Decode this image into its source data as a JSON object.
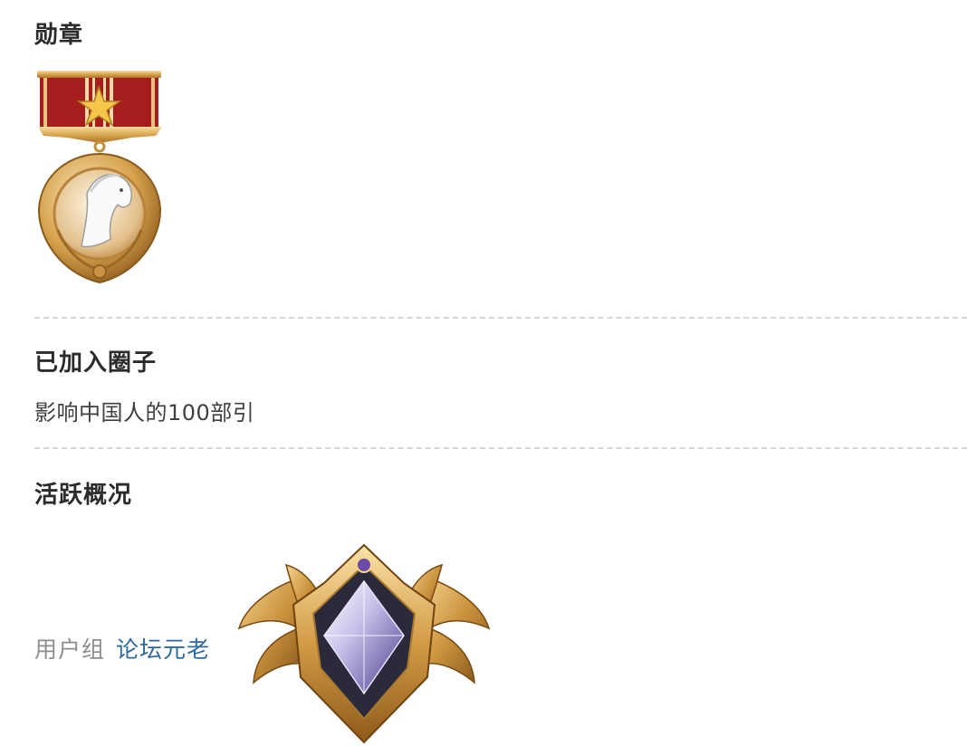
{
  "sections": {
    "medals": {
      "title": "勋章",
      "items": [
        {
          "icon": "horse-medal-icon"
        }
      ]
    },
    "circles": {
      "title": "已加入圈子",
      "items": [
        {
          "name": "影响中国人的100部引"
        }
      ]
    },
    "activity": {
      "title": "活跃概况",
      "user_group": {
        "label": "用户组",
        "value": "论坛元老",
        "badge_icon": "rank-badge-icon"
      }
    }
  },
  "colors": {
    "link": "#2e6a9e",
    "label_gray": "#8e8e8e",
    "title": "#2b2b2b",
    "divider": "#d6d6d6",
    "ribbon_red": "#a51d1d",
    "gold": "#d4a24a"
  }
}
